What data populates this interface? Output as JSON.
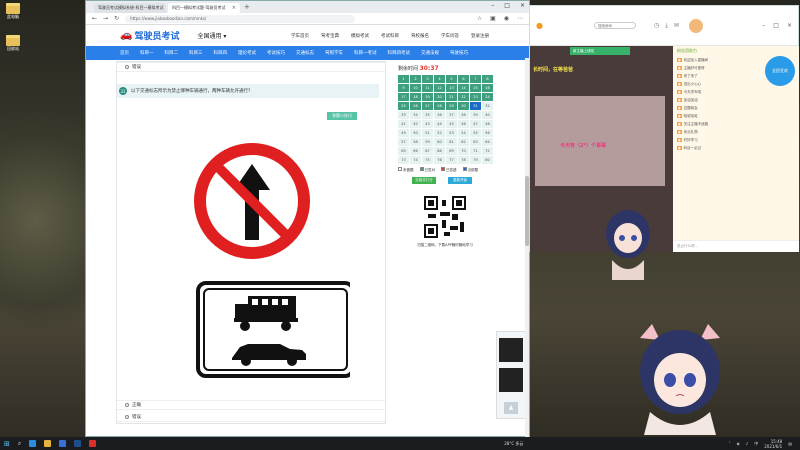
{
  "desktop": {
    "icons": [
      {
        "label": "此电脑"
      },
      {
        "label": "回收站"
      }
    ]
  },
  "browser": {
    "tabs": [
      {
        "label": "驾驶员考试模拟系统-科目一模拟考试"
      },
      {
        "label": "科目一模拟考试题-驾驶员考试"
      }
    ],
    "url": "https://www.jiakaobaodian.com/mnks/"
  },
  "site": {
    "logo_text": "驾驶员考试",
    "city": "全国通用",
    "top_links": [
      "学车首页",
      "驾考宝典",
      "模拟考试",
      "考试科目",
      "驾校报名",
      "学车问答",
      "登录注册"
    ],
    "nav_items": [
      "首页",
      "科目一",
      "科目二",
      "科目三",
      "科目四",
      "理论考试",
      "考试技巧",
      "交通标志",
      "驾照学车",
      "科目一考试",
      "科目四考试",
      "交通法规",
      "驾驶技巧"
    ]
  },
  "question": {
    "prev_option": "错误",
    "number": "31",
    "text": "以下交通标志所示为禁止哪种车辆通行，两种车辆允许通行？",
    "hint_button": "答题小技巧",
    "next_options": [
      "正确",
      "错误"
    ]
  },
  "sidebar": {
    "timer_label": "剩余时间",
    "timer_value": "30:37",
    "cell_numbers": [
      "1",
      "2",
      "3",
      "4",
      "5",
      "6",
      "7",
      "8",
      "9",
      "10",
      "11",
      "12",
      "13",
      "14",
      "15",
      "16",
      "17",
      "18",
      "19",
      "20",
      "21",
      "22",
      "23",
      "24",
      "25",
      "26",
      "27",
      "28",
      "29",
      "30",
      "31",
      "32",
      "33",
      "34",
      "35",
      "36",
      "37",
      "38",
      "39",
      "40",
      "41",
      "42",
      "43",
      "44",
      "45",
      "46",
      "47",
      "48",
      "49",
      "50",
      "51",
      "52",
      "53",
      "54",
      "55",
      "56",
      "57",
      "58",
      "59",
      "60",
      "61",
      "62",
      "63",
      "64",
      "65",
      "66",
      "67",
      "68",
      "69",
      "70",
      "71",
      "72",
      "73",
      "74",
      "75",
      "76",
      "77",
      "78",
      "79",
      "80"
    ],
    "legend": [
      "未做题",
      "已答对",
      "已答错",
      "当前题"
    ],
    "submit_button": "交卷并打分",
    "restart_button": "重新开始",
    "qr_caption": "扫描二维码，下载APP随时随地学习"
  },
  "chat": {
    "search_placeholder": "搜索房间",
    "stream_badge": "新主播上线啦",
    "stream_banner": "长时间，在等爸爸",
    "stream_banner2": "今天有（2*）个哥哥",
    "panel_title": "粉丝团助力",
    "ad_text": "全民狂欢",
    "messages": [
      "欢迎加入直播间",
      "主播好可爱呀",
      "来了来了",
      "送出小心心",
      "今天学车啦",
      "加油加油",
      "这题我会",
      "哈哈哈哈",
      "关注主播不迷路",
      "来点礼物",
      "好好学习",
      "科目一必过"
    ],
    "input_placeholder": "说点什么吧..."
  },
  "taskbar": {
    "weather": "28°C 多云",
    "time": "15:48",
    "date": "2021/6/1"
  }
}
